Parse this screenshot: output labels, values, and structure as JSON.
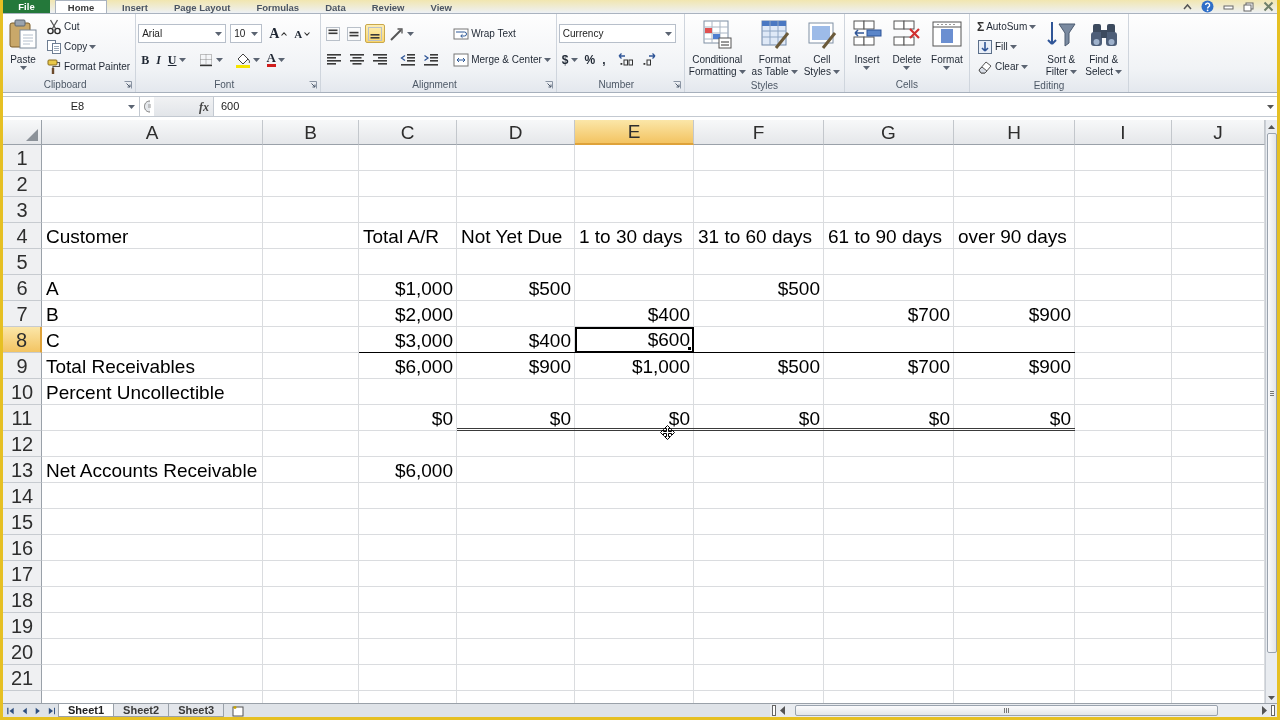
{
  "tabs": [
    {
      "label": "File",
      "selected": false,
      "kind": "file"
    },
    {
      "label": "Home",
      "selected": true,
      "kind": "tab"
    },
    {
      "label": "Insert",
      "selected": false,
      "kind": "tab"
    },
    {
      "label": "Page Layout",
      "selected": false,
      "kind": "tab"
    },
    {
      "label": "Formulas",
      "selected": false,
      "kind": "tab"
    },
    {
      "label": "Data",
      "selected": false,
      "kind": "tab"
    },
    {
      "label": "Review",
      "selected": false,
      "kind": "tab"
    },
    {
      "label": "View",
      "selected": false,
      "kind": "tab"
    }
  ],
  "ribbon": {
    "groups": [
      {
        "label": "Clipboard",
        "launcher": true,
        "columns": [
          {
            "rows": [
              {
                "controls": [
                  {
                    "kind": "paste",
                    "label_lines": [
                      "Paste"
                    ],
                    "dropdown": true
                  }
                ]
              }
            ]
          },
          {
            "rows": [
              {
                "controls": [
                  {
                    "kind": "cut",
                    "label": "Cut"
                  }
                ]
              },
              {
                "controls": [
                  {
                    "kind": "copy",
                    "label": "Copy",
                    "dropdown": true
                  }
                ]
              },
              {
                "controls": [
                  {
                    "kind": "painter",
                    "label": "Format Painter"
                  }
                ]
              }
            ]
          }
        ]
      },
      {
        "label": "Font",
        "launcher": true,
        "columns": [
          {
            "rows": [
              {
                "controls": [
                  {
                    "kind": "font",
                    "value": "Arial"
                  },
                  {
                    "kind": "size",
                    "value": "10"
                  },
                  {
                    "kind": "grow",
                    "label": "A"
                  },
                  {
                    "kind": "shrink",
                    "label": "A"
                  }
                ]
              },
              {
                "controls": [
                  {
                    "kind": "bold",
                    "label": "B"
                  },
                  {
                    "kind": "italic",
                    "label": "I"
                  },
                  {
                    "kind": "underline",
                    "label": "U",
                    "dropdown": true
                  },
                  {
                    "kind": "borders",
                    "dropdown": true
                  },
                  {
                    "kind": "fill",
                    "dropdown": true
                  },
                  {
                    "kind": "fontcolor",
                    "label": "A",
                    "dropdown": true
                  }
                ]
              }
            ]
          }
        ]
      },
      {
        "label": "Alignment",
        "launcher": true,
        "columns": [
          {
            "rows": [
              {
                "controls": [
                  {
                    "kind": "top",
                    "selected": false
                  },
                  {
                    "kind": "middle",
                    "selected": false
                  },
                  {
                    "kind": "bottom",
                    "selected": true
                  },
                  {
                    "kind": "orientation",
                    "dropdown": true
                  }
                ]
              },
              {
                "controls": [
                  {
                    "kind": "left",
                    "selected": false
                  },
                  {
                    "kind": "center",
                    "selected": false
                  },
                  {
                    "kind": "right",
                    "selected": false
                  },
                  {
                    "kind": "outdent"
                  },
                  {
                    "kind": "indent"
                  }
                ]
              }
            ]
          },
          {
            "rows": [
              {
                "controls": [
                  {
                    "kind": "wrap",
                    "label": "Wrap Text"
                  }
                ]
              },
              {
                "controls": [
                  {
                    "kind": "merge",
                    "label": "Merge & Center",
                    "dropdown": true
                  }
                ]
              }
            ]
          }
        ]
      },
      {
        "label": "Number",
        "launcher": true,
        "columns": [
          {
            "rows": [
              {
                "controls": [
                  {
                    "kind": "format",
                    "value": "Currency"
                  }
                ]
              },
              {
                "controls": [
                  {
                    "kind": "currency",
                    "label": "$",
                    "dropdown": true
                  },
                  {
                    "kind": "percent",
                    "label": "%"
                  },
                  {
                    "kind": "comma",
                    "label": ","
                  },
                  {
                    "kind": "decinc"
                  },
                  {
                    "kind": "decdec"
                  }
                ]
              }
            ]
          }
        ]
      },
      {
        "label": "Styles",
        "launcher": false,
        "columns": [
          {
            "rows": [
              {
                "controls": [
                  {
                    "kind": "conditional",
                    "label_lines": [
                      "Conditional",
                      "Formatting"
                    ],
                    "dropdown": true
                  }
                ]
              }
            ]
          },
          {
            "rows": [
              {
                "controls": [
                  {
                    "kind": "table",
                    "label_lines": [
                      "Format",
                      "as Table"
                    ],
                    "dropdown": true
                  }
                ]
              }
            ]
          },
          {
            "rows": [
              {
                "controls": [
                  {
                    "kind": "styles",
                    "label_lines": [
                      "Cell",
                      "Styles"
                    ],
                    "dropdown": true
                  }
                ]
              }
            ]
          }
        ]
      },
      {
        "label": "Cells",
        "launcher": false,
        "columns": [
          {
            "rows": [
              {
                "controls": [
                  {
                    "kind": "insert",
                    "label_lines": [
                      "Insert"
                    ],
                    "dropdown": true
                  }
                ]
              }
            ]
          },
          {
            "rows": [
              {
                "controls": [
                  {
                    "kind": "delete",
                    "label_lines": [
                      "Delete"
                    ],
                    "dropdown": true
                  }
                ]
              }
            ]
          },
          {
            "rows": [
              {
                "controls": [
                  {
                    "kind": "formatcells",
                    "label_lines": [
                      "Format"
                    ],
                    "dropdown": true
                  }
                ]
              }
            ]
          }
        ]
      },
      {
        "label": "Editing",
        "launcher": false,
        "columns": [
          {
            "rows": [
              {
                "controls": [
                  {
                    "kind": "autosum",
                    "symbol": "Σ",
                    "label": "AutoSum",
                    "dropdown": true
                  }
                ]
              },
              {
                "controls": [
                  {
                    "kind": "filldown",
                    "label": "Fill",
                    "dropdown": true
                  }
                ]
              },
              {
                "controls": [
                  {
                    "kind": "clear",
                    "label": "Clear",
                    "dropdown": true
                  }
                ]
              }
            ]
          },
          {
            "rows": [
              {
                "controls": [
                  {
                    "kind": "sort",
                    "label_lines": [
                      "Sort &",
                      "Filter"
                    ],
                    "dropdown": true
                  }
                ]
              }
            ]
          },
          {
            "rows": [
              {
                "controls": [
                  {
                    "kind": "find",
                    "label_lines": [
                      "Find &",
                      "Select"
                    ],
                    "dropdown": true
                  }
                ]
              }
            ]
          }
        ]
      }
    ]
  },
  "formula_bar": {
    "name_box": "E8",
    "function_label": "fx",
    "formula": "600"
  },
  "columns": [
    {
      "label": "A",
      "selected": false
    },
    {
      "label": "B",
      "selected": false
    },
    {
      "label": "C",
      "selected": false
    },
    {
      "label": "D",
      "selected": false
    },
    {
      "label": "E",
      "selected": true
    },
    {
      "label": "F",
      "selected": false
    },
    {
      "label": "G",
      "selected": false
    },
    {
      "label": "H",
      "selected": false
    },
    {
      "label": "I",
      "selected": false
    },
    {
      "label": "J",
      "selected": false
    }
  ],
  "rows": [
    {
      "number": "1",
      "selected": false
    },
    {
      "number": "2",
      "selected": false
    },
    {
      "number": "3",
      "selected": false
    },
    {
      "number": "4",
      "selected": false,
      "cells": [
        {
          "text": "Customer",
          "kind": "text"
        },
        null,
        {
          "text": "Total A/R",
          "kind": "text"
        },
        {
          "text": "Not Yet Due",
          "kind": "text"
        },
        {
          "text": "1 to 30 days",
          "kind": "text"
        },
        {
          "text": "31 to 60 days",
          "kind": "text"
        },
        {
          "text": "61 to 90 days",
          "kind": "text"
        },
        {
          "text": "over 90 days",
          "kind": "text"
        }
      ]
    },
    {
      "number": "5",
      "selected": false
    },
    {
      "number": "6",
      "selected": false,
      "cells": [
        {
          "text": "A",
          "kind": "text"
        },
        null,
        {
          "text": "$1,000",
          "kind": "number"
        },
        {
          "text": "$500",
          "kind": "number"
        },
        null,
        {
          "text": "$500",
          "kind": "number"
        }
      ]
    },
    {
      "number": "7",
      "selected": false,
      "cells": [
        {
          "text": "B",
          "kind": "text"
        },
        null,
        {
          "text": "$2,000",
          "kind": "number"
        },
        null,
        {
          "text": "$400",
          "kind": "number"
        },
        null,
        {
          "text": "$700",
          "kind": "number"
        },
        {
          "text": "$900",
          "kind": "number"
        }
      ]
    },
    {
      "number": "8",
      "selected": true,
      "cells": [
        {
          "text": "C",
          "kind": "text"
        },
        null,
        {
          "text": "$3,000",
          "kind": "number",
          "bottom_border": true
        },
        {
          "text": "$400",
          "kind": "number",
          "bottom_border": true
        },
        {
          "text": "$600",
          "kind": "number",
          "bottom_border": true
        },
        {
          "bottom_border": true
        },
        {
          "bottom_border": true
        },
        {
          "bottom_border": true
        }
      ]
    },
    {
      "number": "9",
      "selected": false,
      "cells": [
        {
          "text": "Total Receivables",
          "kind": "text"
        },
        null,
        {
          "text": "$6,000",
          "kind": "number"
        },
        {
          "text": "$900",
          "kind": "number"
        },
        {
          "text": "$1,000",
          "kind": "number"
        },
        {
          "text": "$500",
          "kind": "number"
        },
        {
          "text": "$700",
          "kind": "number"
        },
        {
          "text": "$900",
          "kind": "number"
        }
      ]
    },
    {
      "number": "10",
      "selected": false,
      "cells": [
        {
          "text": "Percent Uncollectible",
          "kind": "text"
        }
      ]
    },
    {
      "number": "11",
      "selected": false,
      "cells": [
        null,
        null,
        {
          "text": "$0",
          "kind": "number"
        },
        {
          "text": "$0",
          "kind": "number",
          "double_bottom_border": true
        },
        {
          "text": "$0",
          "kind": "number",
          "double_bottom_border": true
        },
        {
          "text": "$0",
          "kind": "number",
          "double_bottom_border": true
        },
        {
          "text": "$0",
          "kind": "number",
          "double_bottom_border": true
        },
        {
          "text": "$0",
          "kind": "number",
          "double_bottom_border": true
        }
      ]
    },
    {
      "number": "12",
      "selected": false
    },
    {
      "number": "13",
      "selected": false,
      "cells": [
        {
          "text": "Net Accounts Receivable",
          "kind": "text"
        },
        null,
        {
          "text": "$6,000",
          "kind": "number"
        }
      ]
    },
    {
      "number": "14",
      "selected": false
    },
    {
      "number": "15",
      "selected": false
    },
    {
      "number": "16",
      "selected": false
    },
    {
      "number": "17",
      "selected": false
    },
    {
      "number": "18",
      "selected": false
    },
    {
      "number": "19",
      "selected": false
    },
    {
      "number": "20",
      "selected": false
    },
    {
      "number": "21",
      "selected": false
    }
  ],
  "sheet_tabs": [
    {
      "label": "Sheet1",
      "selected": true
    },
    {
      "label": "Sheet2",
      "selected": false
    },
    {
      "label": "Sheet3",
      "selected": false
    }
  ]
}
